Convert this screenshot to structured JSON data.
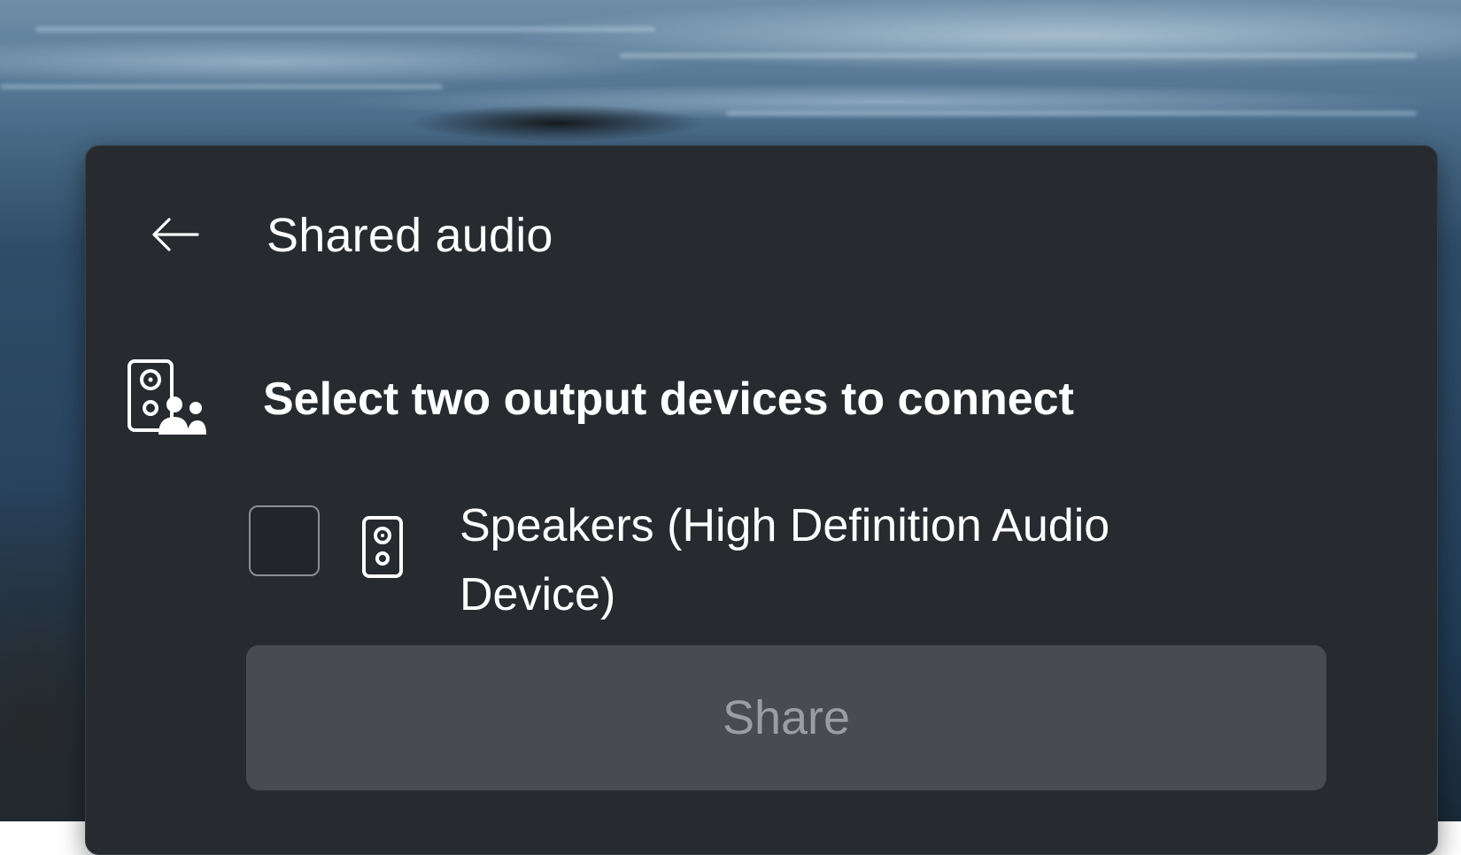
{
  "flyout": {
    "title": "Shared audio",
    "back_icon": "arrow-left-icon"
  },
  "section": {
    "icon": "shared-speakers-icon",
    "label": "Select two output devices to connect"
  },
  "devices": [
    {
      "icon": "speaker-icon",
      "label": "Speakers (High Definition Audio Device)",
      "checked": false
    }
  ],
  "share_button": {
    "label": "Share",
    "enabled": false
  },
  "colors": {
    "panel_bg": "#272b30",
    "text": "#ffffff",
    "disabled_button_bg": "#484c52",
    "disabled_text": "#9a9ea3"
  }
}
